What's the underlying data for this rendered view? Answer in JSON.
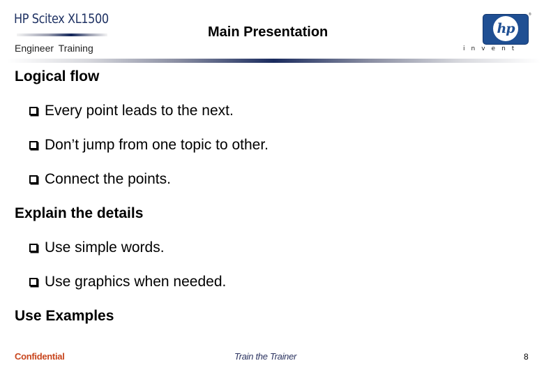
{
  "header": {
    "brand": "HP Scitex XL1500",
    "subtitle": "Engineer  Training",
    "title": "Main Presentation",
    "logo_text": "hp",
    "logo_tagline": "invent"
  },
  "sections": [
    {
      "heading": "Logical flow",
      "bullets": [
        "Every point leads to the next.",
        "Don’t jump from one topic to other.",
        "Connect the points."
      ]
    },
    {
      "heading": "Explain the details",
      "bullets": [
        "Use simple words.",
        "Use graphics when needed."
      ]
    },
    {
      "heading": "Use Examples",
      "bullets": []
    }
  ],
  "footer": {
    "left": "Confidential",
    "center": "Train the Trainer",
    "page_number": "8"
  },
  "colors": {
    "brand_navy": "#1f3263",
    "logo_blue": "#1f4f93",
    "confidential_red": "#c8461e",
    "footer_navy": "#2c3461"
  }
}
